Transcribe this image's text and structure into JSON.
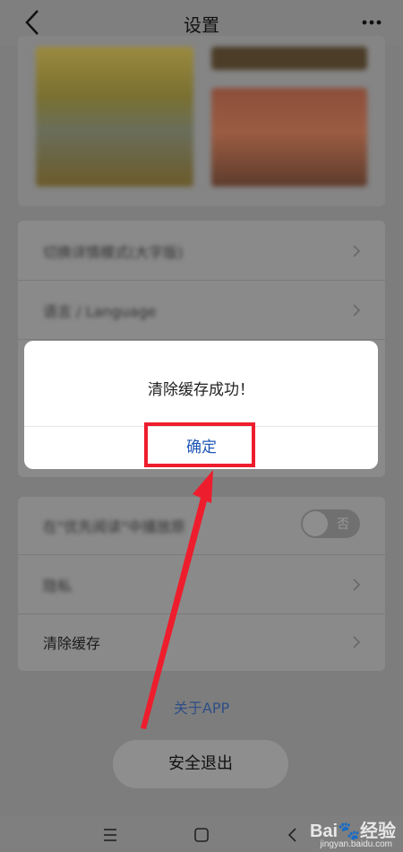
{
  "header": {
    "title": "设置"
  },
  "menu_section_1": {
    "items": [
      {
        "label": "切换详情模式(大字版)"
      },
      {
        "label": "语言 / Language"
      }
    ]
  },
  "menu_section_2": {
    "items": [
      {
        "label": "在\"优先阅读\"中播放原",
        "toggle_text": "否"
      },
      {
        "label": "隐私"
      },
      {
        "label": "清除缓存"
      }
    ]
  },
  "about_link": "关于APP",
  "logout_button": "安全退出",
  "dialog": {
    "message": "清除缓存成功！",
    "confirm_label": "确定"
  },
  "watermark": {
    "brand": "Bai🐾经验",
    "url": "jingyan.baidu.com"
  },
  "colors": {
    "accent_blue": "#1e56b4",
    "annotation_red": "#ee1d2d"
  }
}
